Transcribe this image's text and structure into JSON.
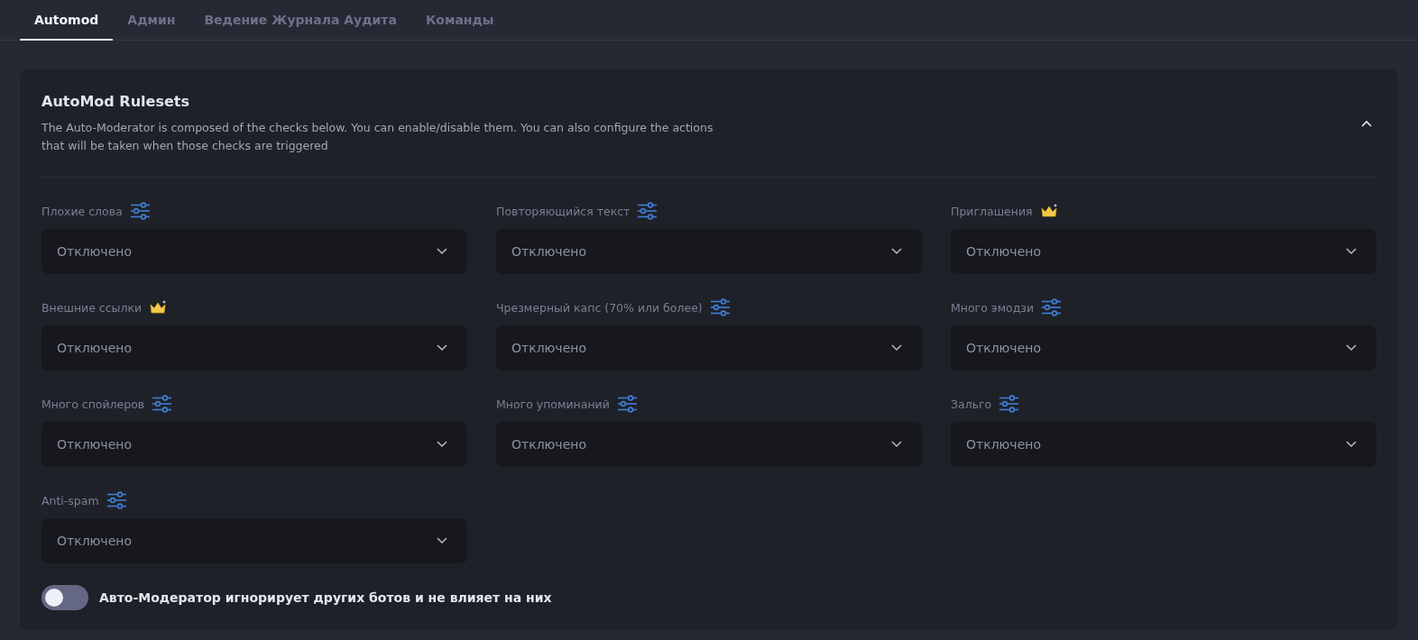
{
  "tabs": [
    {
      "label": "Automod",
      "selected": true
    },
    {
      "label": "Админ",
      "selected": false
    },
    {
      "label": "Ведение Журнала Аудита",
      "selected": false
    },
    {
      "label": "Команды",
      "selected": false
    }
  ],
  "panel": {
    "title": "AutoMod Rulesets",
    "description": "The Auto-Moderator is composed of the checks below. You can enable/disable them. You can also configure the actions that will be taken when those checks are triggered",
    "expanded": true
  },
  "rules": [
    {
      "label": "Плохие слова",
      "kind": "settings",
      "value": "Отключено"
    },
    {
      "label": "Повторяющийся текст",
      "kind": "settings",
      "value": "Отключено"
    },
    {
      "label": "Приглашения",
      "kind": "premium",
      "value": "Отключено"
    },
    {
      "label": "Внешние ссылки",
      "kind": "premium",
      "value": "Отключено"
    },
    {
      "label": "Чрезмерный капс (70% или более)",
      "kind": "settings",
      "value": "Отключено"
    },
    {
      "label": "Много эмодзи",
      "kind": "settings",
      "value": "Отключено"
    },
    {
      "label": "Много спойлеров",
      "kind": "settings",
      "value": "Отключено"
    },
    {
      "label": "Много упоминаний",
      "kind": "settings",
      "value": "Отключено"
    },
    {
      "label": "Зальго",
      "kind": "settings",
      "value": "Отключено"
    },
    {
      "label": "Anti-spam",
      "kind": "settings",
      "value": "Отключено"
    }
  ],
  "ignore_bots": {
    "label": "Авто-Модератор игнорирует других ботов и не влияет на них",
    "on": false
  }
}
